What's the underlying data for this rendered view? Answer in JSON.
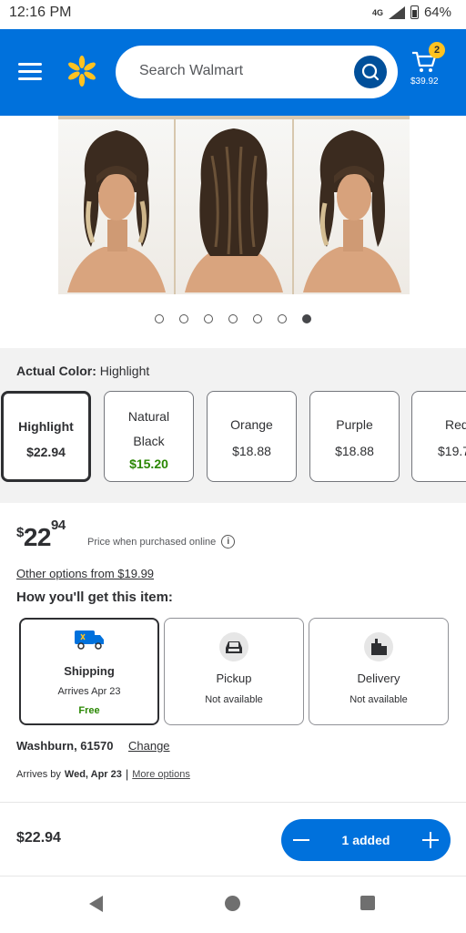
{
  "status_bar": {
    "time": "12:16 PM",
    "network": "4G",
    "battery": "64%"
  },
  "header": {
    "search_placeholder": "Search Walmart",
    "cart_count": "2",
    "cart_total": "$39.92",
    "brand_color": "#0071dc",
    "accent_color": "#ffc220"
  },
  "gallery": {
    "dot_count": 7,
    "active_dot": 6
  },
  "color_section": {
    "actual_label": "Actual Color:",
    "actual_value": "Highlight",
    "swatches": [
      {
        "name": "Highlight",
        "price": "$22.94",
        "selected": true
      },
      {
        "name": "Natural Black",
        "price": "$15.20",
        "selected": false
      },
      {
        "name": "Orange",
        "price": "$18.88",
        "selected": false
      },
      {
        "name": "Purple",
        "price": "$18.88",
        "selected": false
      },
      {
        "name": "Red",
        "price": "$19.7",
        "selected": false
      }
    ]
  },
  "price": {
    "dollar_sign": "$",
    "dollars": "22",
    "cents": "94",
    "note": "Price when purchased online",
    "other_options": "Other options from $19.99",
    "how_get": "How you'll get this item:"
  },
  "fulfillment": [
    {
      "title": "Shipping",
      "sub": "Arrives Apr 23",
      "extra": "Free"
    },
    {
      "title": "Pickup",
      "sub": "Not available"
    },
    {
      "title": "Delivery",
      "sub": "Not available"
    }
  ],
  "location": {
    "place": "Washburn, 61570",
    "change": "Change",
    "arrives_prefix": "Arrives by",
    "arrives_date": "Wed, Apr 23",
    "separator": "|",
    "more_options": "More options"
  },
  "add_bar": {
    "price": "$22.94",
    "qty_label": "1 added"
  }
}
